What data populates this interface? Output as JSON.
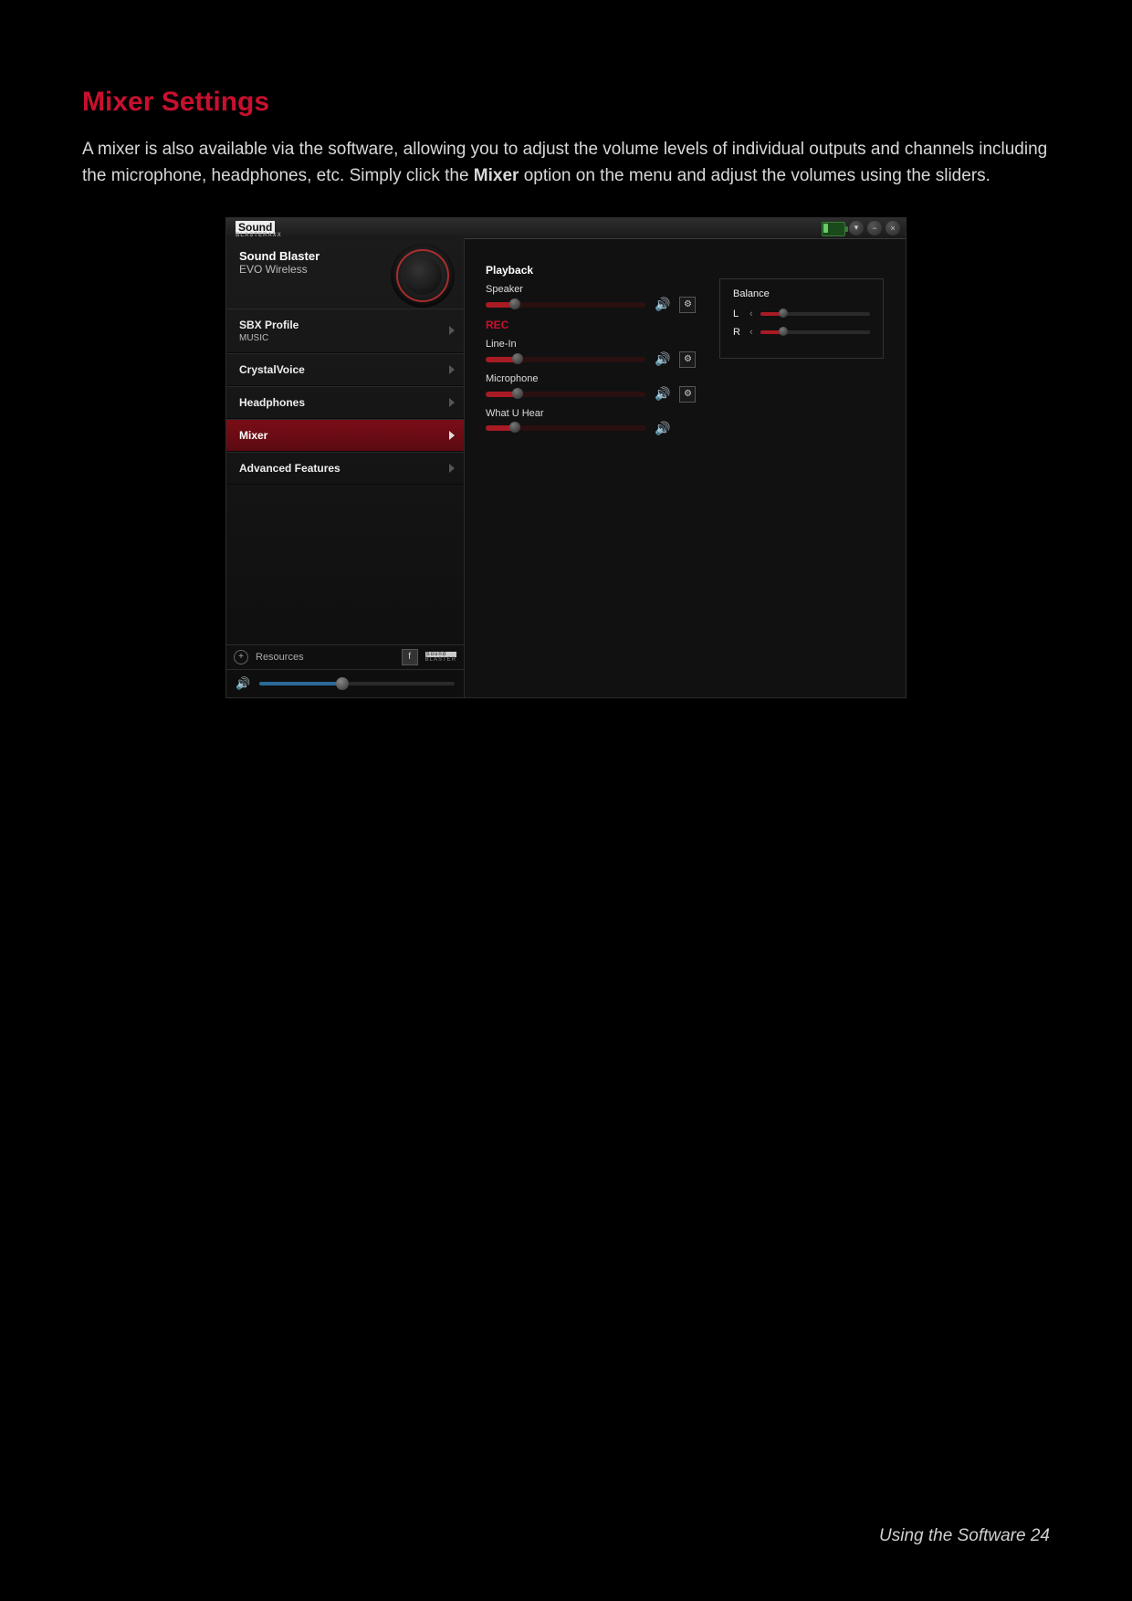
{
  "page": {
    "title": "Mixer Settings",
    "intro_a": "A mixer is also available via the software, allowing you to adjust the volume levels of individual outputs and channels including the microphone, headphones, etc. Simply click the ",
    "intro_bold": "Mixer",
    "intro_b": " option on the menu and adjust the volumes using the sliders.",
    "footer": "Using the Software 24"
  },
  "app": {
    "brand_main": "Sound",
    "brand_sub": "BLASTERAXX",
    "product_line1": "Sound Blaster",
    "product_line2": "EVO Wireless",
    "menu": {
      "sbx": "SBX Profile",
      "sbx_sub": "MUSIC",
      "crystal": "CrystalVoice",
      "headphones": "Headphones",
      "mixer": "Mixer",
      "adv": "Advanced Features"
    },
    "bottom": {
      "resources": "Resources",
      "sb_main": "Sound",
      "sb_sub": "BLASTER"
    },
    "master_volume_pct": 42,
    "content": {
      "playback": "Playback",
      "speaker": "Speaker",
      "speaker_pct": 18,
      "rec": "REC",
      "linein": "Line-In",
      "linein_pct": 20,
      "mic": "Microphone",
      "mic_pct": 20,
      "wuh": "What U Hear",
      "wuh_pct": 18,
      "balance": "Balance",
      "bal_L": "L",
      "bal_R": "R",
      "bal_L_pct": 22,
      "bal_R_pct": 22
    }
  }
}
